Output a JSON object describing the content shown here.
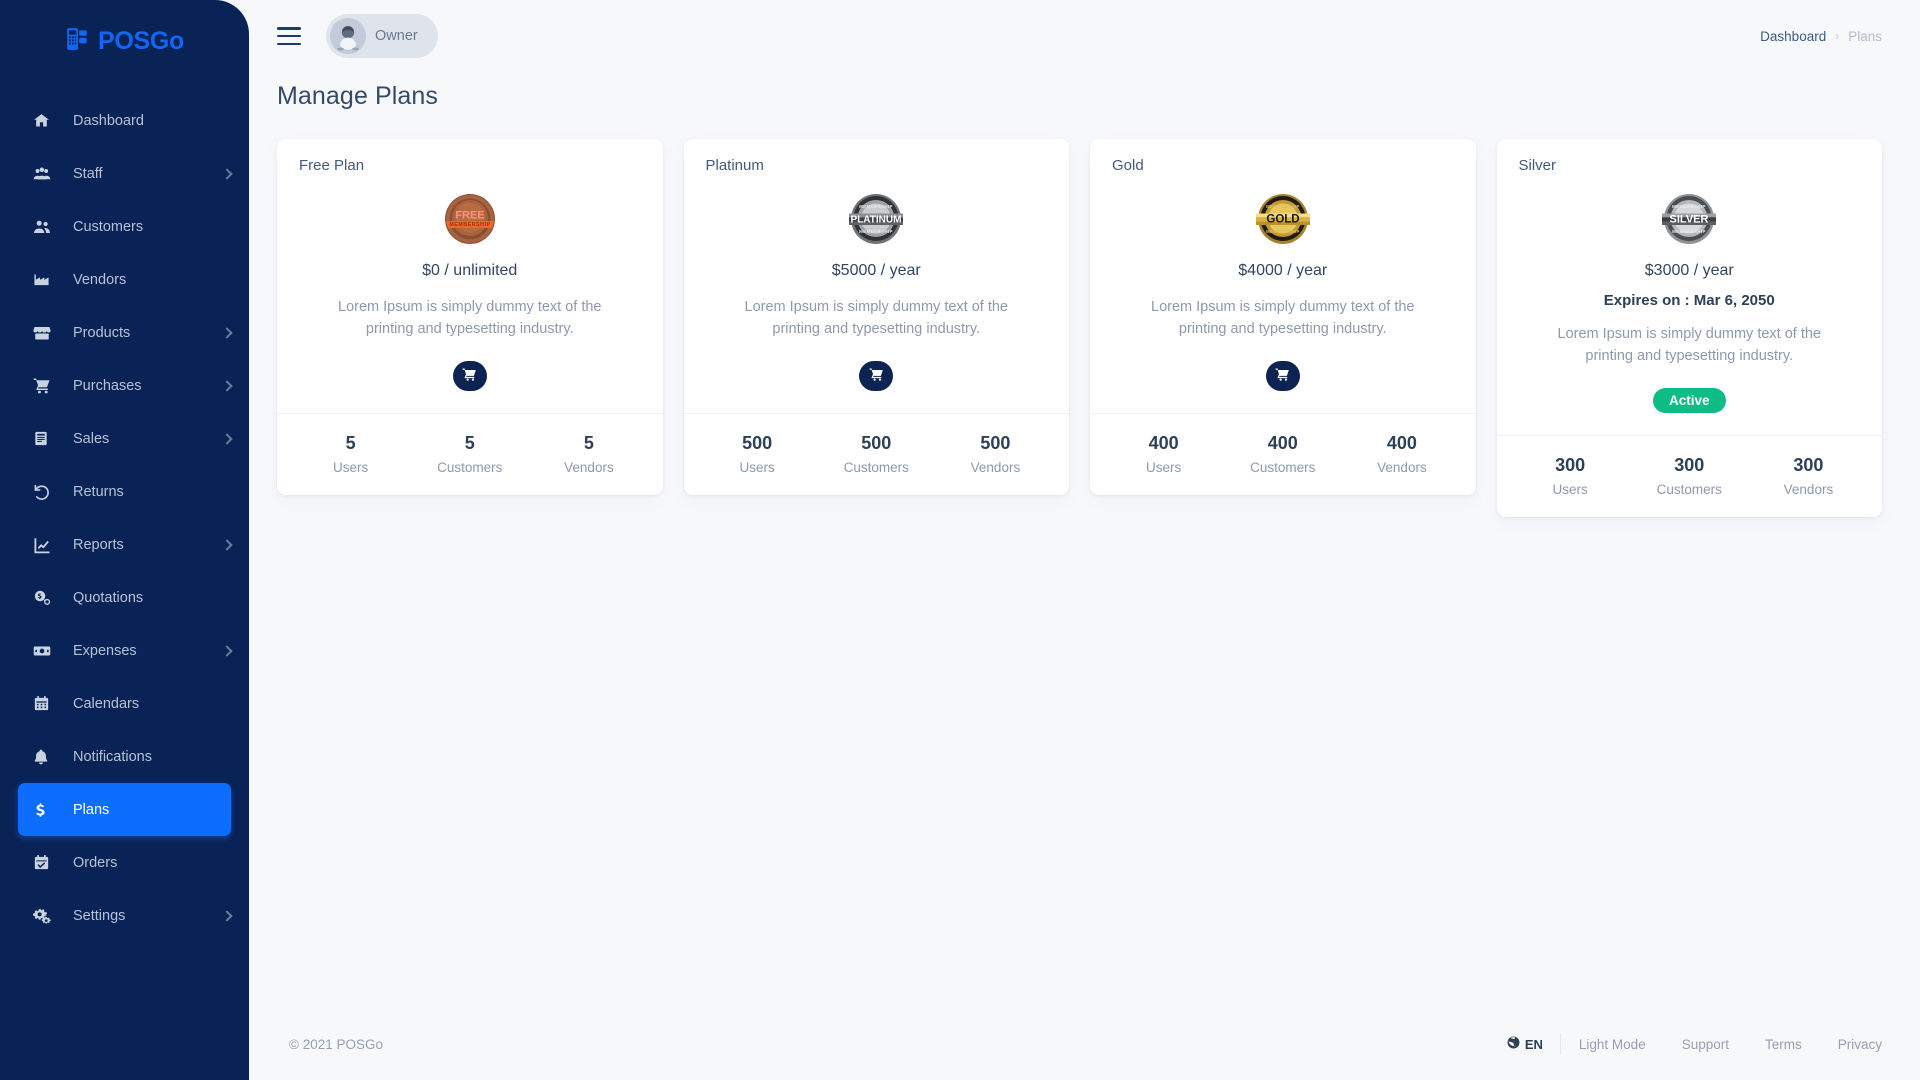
{
  "brand": {
    "name": "POSGo",
    "icon": "pos-terminal-icon"
  },
  "sidebar": {
    "items": [
      {
        "label": "Dashboard",
        "icon": "home-icon",
        "caret": false,
        "active": false
      },
      {
        "label": "Staff",
        "icon": "users-group-icon",
        "caret": true,
        "active": false
      },
      {
        "label": "Customers",
        "icon": "customers-icon",
        "caret": false,
        "active": false
      },
      {
        "label": "Vendors",
        "icon": "factory-icon",
        "caret": false,
        "active": false
      },
      {
        "label": "Products",
        "icon": "store-icon",
        "caret": true,
        "active": false
      },
      {
        "label": "Purchases",
        "icon": "shopping-cart-icon",
        "caret": true,
        "active": false
      },
      {
        "label": "Sales",
        "icon": "receipt-icon",
        "caret": true,
        "active": false
      },
      {
        "label": "Returns",
        "icon": "undo-arrow-icon",
        "caret": false,
        "active": false
      },
      {
        "label": "Reports",
        "icon": "chart-line-icon",
        "caret": true,
        "active": false
      },
      {
        "label": "Quotations",
        "icon": "money-bill-icon",
        "caret": false,
        "active": false
      },
      {
        "label": "Expenses",
        "icon": "banknote-icon",
        "caret": true,
        "active": false
      },
      {
        "label": "Calendars",
        "icon": "calendar-icon",
        "caret": false,
        "active": false
      },
      {
        "label": "Notifications",
        "icon": "bell-icon",
        "caret": false,
        "active": false
      },
      {
        "label": "Plans",
        "icon": "dollar-sign-icon",
        "caret": false,
        "active": true
      },
      {
        "label": "Orders",
        "icon": "calendar-check-icon",
        "caret": false,
        "active": false
      },
      {
        "label": "Settings",
        "icon": "gears-icon",
        "caret": true,
        "active": false
      }
    ]
  },
  "topbar": {
    "menu_toggle": "hamburger-icon",
    "owner_label": "Owner",
    "avatar": "user-avatar-icon"
  },
  "breadcrumb": {
    "parent": "Dashboard",
    "separator": "›",
    "current": "Plans"
  },
  "page": {
    "title": "Manage Plans"
  },
  "plans": [
    {
      "name": "Free Plan",
      "badge": "free-membership-badge-icon",
      "badge_label": "FREE",
      "price": "$0 / unlimited",
      "expires": null,
      "description": "Lorem Ipsum is simply dummy text of the printing and typesetting industry.",
      "action": {
        "type": "cart-button",
        "icon": "shopping-cart-icon"
      },
      "status": null,
      "stats": [
        {
          "value": "5",
          "label": "Users"
        },
        {
          "value": "5",
          "label": "Customers"
        },
        {
          "value": "5",
          "label": "Vendors"
        }
      ]
    },
    {
      "name": "Platinum",
      "badge": "platinum-membership-badge-icon",
      "badge_label": "PLATINUM",
      "price": "$5000 / year",
      "expires": null,
      "description": "Lorem Ipsum is simply dummy text of the printing and typesetting industry.",
      "action": {
        "type": "cart-button",
        "icon": "shopping-cart-icon"
      },
      "status": null,
      "stats": [
        {
          "value": "500",
          "label": "Users"
        },
        {
          "value": "500",
          "label": "Customers"
        },
        {
          "value": "500",
          "label": "Vendors"
        }
      ]
    },
    {
      "name": "Gold",
      "badge": "gold-membership-badge-icon",
      "badge_label": "GOLD",
      "price": "$4000 / year",
      "expires": null,
      "description": "Lorem Ipsum is simply dummy text of the printing and typesetting industry.",
      "action": {
        "type": "cart-button",
        "icon": "shopping-cart-icon"
      },
      "status": null,
      "stats": [
        {
          "value": "400",
          "label": "Users"
        },
        {
          "value": "400",
          "label": "Customers"
        },
        {
          "value": "400",
          "label": "Vendors"
        }
      ]
    },
    {
      "name": "Silver",
      "badge": "silver-membership-badge-icon",
      "badge_label": "SILVER",
      "price": "$3000 / year",
      "expires": "Expires on : Mar 6, 2050",
      "description": "Lorem Ipsum is simply dummy text of the printing and typesetting industry.",
      "action": null,
      "status": "Active",
      "stats": [
        {
          "value": "300",
          "label": "Users"
        },
        {
          "value": "300",
          "label": "Customers"
        },
        {
          "value": "300",
          "label": "Vendors"
        }
      ]
    }
  ],
  "footer": {
    "copyright": "© 2021 POSGo",
    "language": "EN",
    "language_icon": "globe-icon",
    "links": [
      "Light Mode",
      "Support",
      "Terms",
      "Privacy"
    ]
  },
  "colors": {
    "sidebar_bg": "#0a2356",
    "accent": "#0d6efd",
    "brand": "#1366f2",
    "page_bg": "#f7f8fa",
    "card_bg": "#ffffff",
    "status_active": "#0dbd84",
    "cart_btn": "#0d2452",
    "text_dark": "#2e4057",
    "text_muted": "#8e99ab"
  }
}
